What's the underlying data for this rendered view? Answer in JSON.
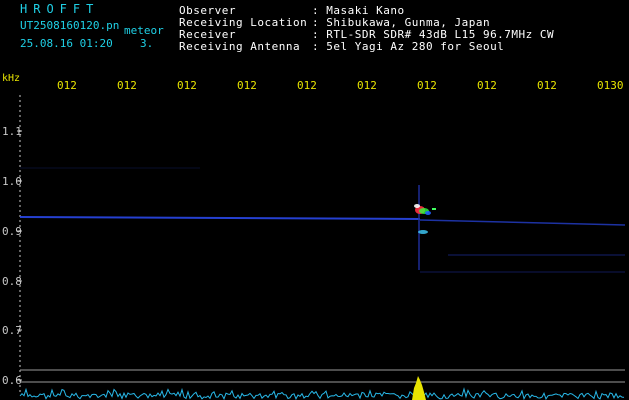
{
  "header": {
    "title": "HROFFT",
    "filename": "UT2508160120.pn",
    "type": "meteor",
    "datetime": "25.08.16 01:20",
    "count": "3.",
    "observer_label": "Observer",
    "observer_value": ": Masaki Kano",
    "location_label": "Receiving Location",
    "location_value": ": Shibukawa, Gunma, Japan",
    "receiver_label": "Receiver",
    "receiver_value": ": RTL-SDR SDR# 43dB L15 96.7MHz CW",
    "antenna_label": "Receiving Antenna",
    "antenna_value": ": 5el Yagi Az 280 for Seoul"
  },
  "axis": {
    "unit": "kHz",
    "time_ticks": [
      "012",
      "012",
      "012",
      "012",
      "012",
      "012",
      "012",
      "012",
      "012",
      "0130"
    ],
    "freq_ticks": [
      "1.1",
      "1.0",
      "0.9",
      "0.8",
      "0.7",
      "0.6"
    ]
  },
  "colors": {
    "header_text": "#1fd0e6",
    "info_text": "#ffffff",
    "tick_text": "#e8e400",
    "carrier": "#3050ff",
    "noise_floor": "#28b8e8"
  }
}
